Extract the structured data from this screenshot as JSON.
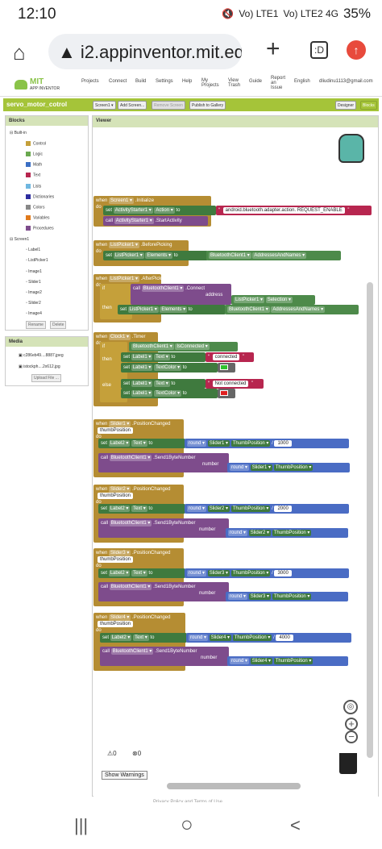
{
  "status": {
    "time": "12:10",
    "signal1": "Vo) LTE1",
    "signal2": "Vo) LTE2 4G",
    "battery": "35%"
  },
  "browser": {
    "url": "i2.appinventor.mit.edu",
    "tabs": ":D"
  },
  "header": {
    "logo_title": "MIT",
    "logo_sub": "APP INVENTOR",
    "menu": [
      "Projects",
      "Connect",
      "Build",
      "Settings",
      "Help",
      "My Projects",
      "View Trash",
      "Guide",
      "Report an Issue",
      "English",
      "dliudinu1113@gmail.com"
    ]
  },
  "project": {
    "name": "servo_motor_cotrol",
    "screen": "Screen1 ▾",
    "add_screen": "Add Screen...",
    "remove_screen": "Remove Screen",
    "publish": "Publish to Gallery",
    "designer": "Designer",
    "blocks": "Blocks"
  },
  "blocks_panel": {
    "title": "Blocks",
    "built_in": "Built-in",
    "items": [
      {
        "label": "Control",
        "color": "#c5a03a"
      },
      {
        "label": "Logic",
        "color": "#6aa84f"
      },
      {
        "label": "Math",
        "color": "#3c6fc4"
      },
      {
        "label": "Text",
        "color": "#b7264f"
      },
      {
        "label": "Lists",
        "color": "#6fb7e0"
      },
      {
        "label": "Dictionaries",
        "color": "#2d2d9f"
      },
      {
        "label": "Colors",
        "color": "#888888"
      },
      {
        "label": "Variables",
        "color": "#e07a1c"
      },
      {
        "label": "Procedures",
        "color": "#7e4c8c"
      }
    ],
    "screen": "Screen1",
    "components": [
      "Label1",
      "ListPicker1",
      "Image1",
      "Slider1",
      "Image2",
      "Slider2",
      "Image4"
    ],
    "rename": "Rename",
    "delete": "Delete"
  },
  "media": {
    "title": "Media",
    "files": [
      "c286eb49....8887.jpeg",
      "istockph....2x612.jpg"
    ],
    "upload": "Upload File ..."
  },
  "viewer": {
    "title": "Viewer"
  },
  "b_screen": {
    "when": "when",
    "comp": "Screen1 ▾",
    "event": ".Initialize",
    "do": "do",
    "set": "set",
    "act": "ActivityStarter1 ▾",
    "action": "Action ▾",
    "to": "to",
    "value": "android.bluetooth.adapter.action. REQUEST_ENABLE",
    "call": "call",
    "callcomp": "ActivityStarter1 ▾",
    "method": ".StartActivity"
  },
  "b_before": {
    "comp": "ListPicker1 ▾",
    "event": ".BeforePicking",
    "setcomp": "ListPicker1 ▾",
    "prop": "Elements ▾",
    "get": "BluetoothClient1 ▾",
    "getprop": "AddressesAndNames ▾"
  },
  "b_after": {
    "comp": "ListPicker1 ▾",
    "event": ".AfterPicking",
    "if": "if",
    "bt": "BluetoothClient1 ▾",
    "method": ".Connect",
    "address": "address",
    "lp": "ListPicker1 ▾",
    "sel": "Selection ▾",
    "then": "then",
    "setcomp": "ListPicker1 ▾",
    "prop": "Elements ▾",
    "get": "BluetoothClient1 ▾",
    "getprop": "AddressesAndNames ▾"
  },
  "b_clock": {
    "comp": "Clock1 ▾",
    "event": ".Timer",
    "bt": "BluetoothClient1 ▾",
    "isc": "IsConnected ▾",
    "label": "Label1 ▾",
    "text": "Text ▾",
    "textcolor": "TextColor ▾",
    "connected": "connected",
    "else": "else",
    "notconnected": "Not connected",
    "green": "#2ec22e",
    "red": "#e02020"
  },
  "b_sliders": [
    {
      "slider": "Slider1 ▾",
      "event": ".PositionChanged",
      "param": "thumbPosition",
      "label": "Label2 ▾",
      "text": "Text ▾",
      "round": "round ▾",
      "thumb": "ThumbPosition ▾",
      "div": "/",
      "num": "1000",
      "bt": "BluetoothClient1 ▾",
      "send": ".Send1ByteNumber",
      "number": "number"
    },
    {
      "slider": "Slider2 ▾",
      "event": ".PositionChanged",
      "param": "thumbPosition",
      "label": "Label2 ▾",
      "text": "Text ▾",
      "round": "round ▾",
      "thumb": "ThumbPosition ▾",
      "div": "/",
      "num": "2000",
      "bt": "BluetoothClient1 ▾",
      "send": ".Send1ByteNumber",
      "number": "number"
    },
    {
      "slider": "Slider3 ▾",
      "event": ".PositionChanged",
      "param": "thumbPosition",
      "label": "Label2 ▾",
      "text": "Text ▾",
      "round": "round ▾",
      "thumb": "ThumbPosition ▾",
      "div": "/",
      "num": "3000",
      "bt": "BluetoothClient1 ▾",
      "send": ".Send1ByteNumber",
      "number": "number"
    },
    {
      "slider": "Slider4 ▾",
      "event": ".PositionChanged",
      "param": "thumbPosition",
      "label": "Label2 ▾",
      "text": "Text ▾",
      "round": "round ▾",
      "thumb": "ThumbPosition ▾",
      "div": "/",
      "num": "4000",
      "bt": "BluetoothClient1 ▾",
      "send": ".Send1ByteNumber",
      "number": "number"
    }
  ],
  "warnings": {
    "warn_count": "0",
    "err_count": "0",
    "show": "Show Warnings"
  },
  "footer": "Privacy Policy and Terms of Use",
  "nav": {
    "recent": "|||",
    "home": "○",
    "back": "<"
  }
}
